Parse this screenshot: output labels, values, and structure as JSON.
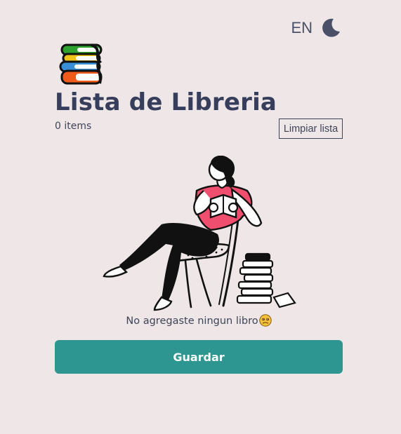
{
  "header": {
    "language_label": "EN",
    "theme_icon": "moon-icon"
  },
  "logo": {
    "icon": "books-stack-icon",
    "colors": [
      "#2fa12f",
      "#f0c419",
      "#3a8fd8",
      "#f05a1a"
    ]
  },
  "list": {
    "title": "Lista de Libreria",
    "item_count": "0 items",
    "clear_label": "Limpiar lista"
  },
  "empty_state": {
    "illustration": "person-reading-illustration",
    "message": "No agregaste ningun libro",
    "emoji": "worried-face-emoji"
  },
  "actions": {
    "save_label": "Guardar"
  },
  "colors": {
    "background": "#efe6e7",
    "primary": "#2e9690",
    "text": "#363e5c",
    "accent_shirt": "#f04e6e"
  }
}
